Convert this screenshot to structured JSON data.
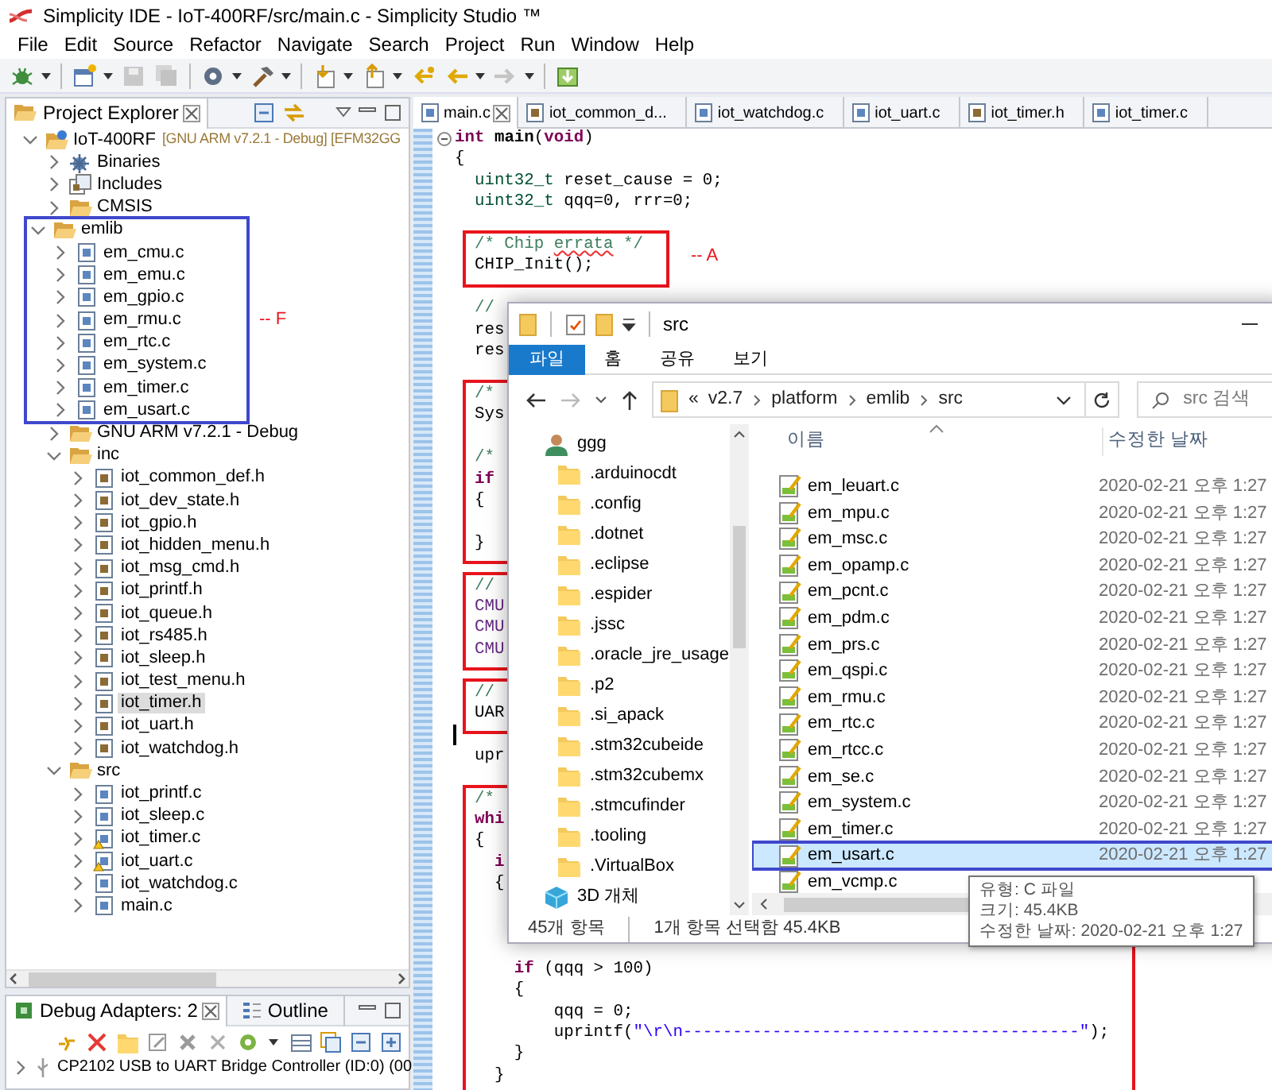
{
  "window": {
    "title": "Simplicity IDE - IoT-400RF/src/main.c - Simplicity Studio ™"
  },
  "menu": [
    "File",
    "Edit",
    "Source",
    "Refactor",
    "Navigate",
    "Search",
    "Project",
    "Run",
    "Window",
    "Help"
  ],
  "project_explorer": {
    "title": "Project Explorer",
    "tree": [
      {
        "label": "IoT-400RF",
        "kind": "project",
        "decoration": "[GNU ARM v7.2.1 - Debug] [EFM32GG",
        "expanded": true,
        "selected": false,
        "children": [
          {
            "label": "Binaries",
            "kind": "binaries",
            "expanded": false,
            "selected": false
          },
          {
            "label": "Includes",
            "kind": "includes",
            "expanded": false,
            "selected": false
          },
          {
            "label": "CMSIS",
            "kind": "folder",
            "expanded": false,
            "selected": false
          },
          {
            "label": "emlib",
            "kind": "folder",
            "expanded": true,
            "selected": false,
            "note": "-- F",
            "children": [
              {
                "label": "em_cmu.c",
                "kind": "c-file",
                "expanded": false,
                "selected": false
              },
              {
                "label": "em_emu.c",
                "kind": "c-file",
                "expanded": false,
                "selected": false
              },
              {
                "label": "em_gpio.c",
                "kind": "c-file",
                "expanded": false,
                "selected": false
              },
              {
                "label": "em_rmu.c",
                "kind": "c-file",
                "expanded": false,
                "selected": false
              },
              {
                "label": "em_rtc.c",
                "kind": "c-file",
                "expanded": false,
                "selected": false
              },
              {
                "label": "em_system.c",
                "kind": "c-file",
                "expanded": false,
                "selected": false
              },
              {
                "label": "em_timer.c",
                "kind": "c-file",
                "expanded": false,
                "selected": false
              },
              {
                "label": "em_usart.c",
                "kind": "c-file",
                "expanded": false,
                "selected": false
              }
            ]
          },
          {
            "label": "GNU ARM v7.2.1 - Debug",
            "kind": "folder",
            "expanded": false,
            "selected": false
          },
          {
            "label": "inc",
            "kind": "folder",
            "expanded": true,
            "selected": false,
            "children": [
              {
                "label": "iot_common_def.h",
                "kind": "h-file",
                "expanded": false,
                "selected": false
              },
              {
                "label": "iot_dev_state.h",
                "kind": "h-file",
                "expanded": false,
                "selected": false
              },
              {
                "label": "iot_gpio.h",
                "kind": "h-file",
                "expanded": false,
                "selected": false
              },
              {
                "label": "iot_hidden_menu.h",
                "kind": "h-file",
                "expanded": false,
                "selected": false
              },
              {
                "label": "iot_msg_cmd.h",
                "kind": "h-file",
                "expanded": false,
                "selected": false
              },
              {
                "label": "iot_printf.h",
                "kind": "h-file",
                "expanded": false,
                "selected": false
              },
              {
                "label": "iot_queue.h",
                "kind": "h-file",
                "expanded": false,
                "selected": false
              },
              {
                "label": "iot_rs485.h",
                "kind": "h-file",
                "expanded": false,
                "selected": false
              },
              {
                "label": "iot_sleep.h",
                "kind": "h-file",
                "expanded": false,
                "selected": false
              },
              {
                "label": "iot_test_menu.h",
                "kind": "h-file",
                "expanded": false,
                "selected": false
              },
              {
                "label": "iot_timer.h",
                "kind": "h-file",
                "expanded": false,
                "selected": true
              },
              {
                "label": "iot_uart.h",
                "kind": "h-file",
                "expanded": false,
                "selected": false
              },
              {
                "label": "iot_watchdog.h",
                "kind": "h-file",
                "expanded": false,
                "selected": false
              }
            ]
          },
          {
            "label": "src",
            "kind": "folder",
            "expanded": true,
            "selected": false,
            "children": [
              {
                "label": "iot_printf.c",
                "kind": "c-file",
                "expanded": false,
                "selected": false
              },
              {
                "label": "iot_sleep.c",
                "kind": "c-file",
                "expanded": false,
                "selected": false
              },
              {
                "label": "iot_timer.c",
                "kind": "c-file",
                "warning": true,
                "expanded": false,
                "selected": false
              },
              {
                "label": "iot_uart.c",
                "kind": "c-file",
                "warning": true,
                "expanded": false,
                "selected": false
              },
              {
                "label": "iot_watchdog.c",
                "kind": "c-file",
                "expanded": false,
                "selected": false
              },
              {
                "label": "main.c",
                "kind": "c-file",
                "expanded": false,
                "selected": false
              }
            ]
          }
        ]
      }
    ]
  },
  "debug_panel": {
    "tabs": [
      {
        "label": "Debug Adapters: 2",
        "selected": true
      },
      {
        "label": "Outline",
        "selected": false
      }
    ],
    "rows": [
      {
        "label": "CP2102 USB to UART Bridge Controller (ID:0) (00",
        "expanded": false
      }
    ]
  },
  "editor": {
    "tabs": [
      {
        "label": "main.c",
        "kind": "c",
        "selected": true
      },
      {
        "label": "iot_common_d...",
        "kind": "h",
        "selected": false
      },
      {
        "label": "iot_watchdog.c",
        "kind": "c",
        "selected": false
      },
      {
        "label": "iot_uart.c",
        "kind": "c",
        "selected": false
      },
      {
        "label": "iot_timer.h",
        "kind": "h",
        "selected": false
      },
      {
        "label": "iot_timer.c",
        "kind": "c",
        "selected": false
      }
    ],
    "blocks": [
      {
        "framed": false,
        "lines": [
          {
            "kind": "code",
            "foldable": true,
            "segments": [
              {
                "text": "int",
                "kind": "keyword"
              },
              {
                "text": " main",
                "kind": "function"
              },
              {
                "text": "(",
                "kind": "plain"
              },
              {
                "text": "void",
                "kind": "keyword"
              },
              {
                "text": ")",
                "kind": "plain"
              }
            ]
          },
          {
            "kind": "code",
            "segments": [
              {
                "text": "{",
                "kind": "plain"
              }
            ]
          },
          {
            "kind": "code",
            "segments": [
              {
                "text": "  uint32_t",
                "kind": "type"
              },
              {
                "text": " reset_cause = 0;",
                "kind": "plain"
              }
            ]
          },
          {
            "kind": "code",
            "segments": [
              {
                "text": "  uint32_t",
                "kind": "type"
              },
              {
                "text": " qqq=0, rrr=0;",
                "kind": "plain"
              }
            ]
          },
          {
            "kind": "blank"
          }
        ]
      },
      {
        "framed": true,
        "note": "-- A",
        "lines": [
          {
            "kind": "code",
            "segments": [
              {
                "text": "  /* Chip ",
                "kind": "comment"
              },
              {
                "text": "errata",
                "kind": "misspelled"
              },
              {
                "text": " */",
                "kind": "comment"
              }
            ]
          },
          {
            "kind": "code",
            "segments": [
              {
                "text": "  CHIP_Init();",
                "kind": "plain"
              }
            ]
          }
        ]
      },
      {
        "framed": false,
        "lines": [
          {
            "kind": "blank"
          },
          {
            "kind": "code",
            "segments": [
              {
                "text": "  //",
                "kind": "comment"
              }
            ]
          },
          {
            "kind": "code",
            "segments": [
              {
                "text": "  res",
                "kind": "plain"
              }
            ]
          },
          {
            "kind": "code",
            "segments": [
              {
                "text": "  res",
                "kind": "plain"
              }
            ]
          },
          {
            "kind": "blank"
          }
        ]
      },
      {
        "framed": true,
        "lines": [
          {
            "kind": "code",
            "segments": [
              {
                "text": "  /*",
                "kind": "comment"
              }
            ]
          },
          {
            "kind": "code",
            "segments": [
              {
                "text": "  Sys",
                "kind": "plain"
              }
            ]
          },
          {
            "kind": "blank"
          },
          {
            "kind": "code",
            "segments": [
              {
                "text": "  /*",
                "kind": "comment"
              }
            ]
          },
          {
            "kind": "code",
            "segments": [
              {
                "text": "  if",
                "kind": "keyword"
              }
            ]
          },
          {
            "kind": "code",
            "segments": [
              {
                "text": "  {",
                "kind": "plain"
              }
            ]
          },
          {
            "kind": "blank"
          },
          {
            "kind": "code",
            "segments": [
              {
                "text": "  }",
                "kind": "plain"
              }
            ]
          }
        ]
      },
      {
        "framed": false,
        "lines": [
          {
            "kind": "blank"
          }
        ]
      },
      {
        "framed": true,
        "lines": [
          {
            "kind": "code",
            "segments": [
              {
                "text": "  //",
                "kind": "comment"
              }
            ]
          },
          {
            "kind": "code",
            "segments": [
              {
                "text": "  CMU",
                "kind": "macro"
              }
            ]
          },
          {
            "kind": "code",
            "segments": [
              {
                "text": "  CMU",
                "kind": "macro"
              }
            ]
          },
          {
            "kind": "code",
            "segments": [
              {
                "text": "  CMU",
                "kind": "macro"
              }
            ]
          }
        ]
      },
      {
        "framed": false,
        "lines": [
          {
            "kind": "blank"
          }
        ]
      },
      {
        "framed": true,
        "lines": [
          {
            "kind": "code",
            "segments": [
              {
                "text": "  //",
                "kind": "comment"
              }
            ]
          },
          {
            "kind": "code",
            "segments": [
              {
                "text": "  UAR",
                "kind": "plain"
              }
            ]
          }
        ]
      },
      {
        "framed": false,
        "lines": [
          {
            "kind": "caret"
          },
          {
            "kind": "code",
            "segments": [
              {
                "text": "  upr",
                "kind": "plain"
              }
            ]
          },
          {
            "kind": "blank"
          }
        ]
      },
      {
        "framed": true,
        "lines": [
          {
            "kind": "code",
            "segments": [
              {
                "text": "  /*",
                "kind": "comment"
              }
            ]
          },
          {
            "kind": "code",
            "segments": [
              {
                "text": "  whi",
                "kind": "keyword"
              }
            ]
          },
          {
            "kind": "code",
            "segments": [
              {
                "text": "  {",
                "kind": "plain"
              }
            ]
          },
          {
            "kind": "code",
            "segments": [
              {
                "text": "    i",
                "kind": "keyword"
              }
            ]
          },
          {
            "kind": "code",
            "segments": [
              {
                "text": "    {",
                "kind": "plain"
              }
            ]
          },
          {
            "kind": "blank"
          },
          {
            "kind": "blank"
          },
          {
            "kind": "blank"
          },
          {
            "kind": "code",
            "segments": [
              {
                "text": "      if",
                "kind": "keyword"
              },
              {
                "text": " (qqq > 100)",
                "kind": "plain"
              }
            ]
          },
          {
            "kind": "code",
            "segments": [
              {
                "text": "      {",
                "kind": "plain"
              }
            ]
          },
          {
            "kind": "code",
            "segments": [
              {
                "text": "          qqq = 0;",
                "kind": "plain"
              }
            ]
          },
          {
            "kind": "code",
            "segments": [
              {
                "text": "          uprintf(",
                "kind": "plain"
              },
              {
                "text": "\"\\r\\n----------------------------------------\"",
                "kind": "string"
              },
              {
                "text": ");",
                "kind": "plain"
              }
            ]
          },
          {
            "kind": "code",
            "segments": [
              {
                "text": "      }",
                "kind": "plain"
              }
            ]
          },
          {
            "kind": "code",
            "segments": [
              {
                "text": "    }",
                "kind": "plain"
              }
            ]
          }
        ]
      }
    ]
  },
  "file_explorer": {
    "title": "src",
    "ribbon_tabs": [
      {
        "label": "파일",
        "selected": true
      },
      {
        "label": "홈",
        "selected": false
      },
      {
        "label": "공유",
        "selected": false
      },
      {
        "label": "보기",
        "selected": false
      }
    ],
    "overflow": "«",
    "path": [
      "v2.7",
      "platform",
      "emlib",
      "src"
    ],
    "search": {
      "placeholder": "src 검색"
    },
    "nav": [
      {
        "label": "ggg",
        "kind": "user",
        "selected": false
      },
      {
        "label": ".arduinocdt",
        "kind": "folder",
        "selected": false
      },
      {
        "label": ".config",
        "kind": "folder",
        "selected": false
      },
      {
        "label": ".dotnet",
        "kind": "folder",
        "selected": false
      },
      {
        "label": ".eclipse",
        "kind": "folder",
        "selected": false
      },
      {
        "label": ".espider",
        "kind": "folder",
        "selected": false
      },
      {
        "label": ".jssc",
        "kind": "folder",
        "selected": false
      },
      {
        "label": ".oracle_jre_usage",
        "kind": "folder",
        "selected": false
      },
      {
        "label": ".p2",
        "kind": "folder",
        "selected": false
      },
      {
        "label": ".si_apack",
        "kind": "folder",
        "selected": false
      },
      {
        "label": ".stm32cubeide",
        "kind": "folder",
        "selected": false
      },
      {
        "label": ".stm32cubemx",
        "kind": "folder",
        "selected": false
      },
      {
        "label": ".stmcufinder",
        "kind": "folder",
        "selected": false
      },
      {
        "label": ".tooling",
        "kind": "folder",
        "selected": false
      },
      {
        "label": ".VirtualBox",
        "kind": "folder",
        "selected": false
      },
      {
        "label": "3D 개체",
        "kind": "objects3d",
        "selected": false
      }
    ],
    "columns": [
      "이름",
      "수정한 날짜"
    ],
    "files": [
      {
        "name": "em_leuart.c",
        "date": "2020-02-21 오후 1:27",
        "selected": false,
        "framed": false
      },
      {
        "name": "em_mpu.c",
        "date": "2020-02-21 오후 1:27",
        "selected": false,
        "framed": false
      },
      {
        "name": "em_msc.c",
        "date": "2020-02-21 오후 1:27",
        "selected": false,
        "framed": false
      },
      {
        "name": "em_opamp.c",
        "date": "2020-02-21 오후 1:27",
        "selected": false,
        "framed": false
      },
      {
        "name": "em_pcnt.c",
        "date": "2020-02-21 오후 1:27",
        "selected": false,
        "framed": false
      },
      {
        "name": "em_pdm.c",
        "date": "2020-02-21 오후 1:27",
        "selected": false,
        "framed": false
      },
      {
        "name": "em_prs.c",
        "date": "2020-02-21 오후 1:27",
        "selected": false,
        "framed": false
      },
      {
        "name": "em_qspi.c",
        "date": "2020-02-21 오후 1:27",
        "selected": false,
        "framed": false
      },
      {
        "name": "em_rmu.c",
        "date": "2020-02-21 오후 1:27",
        "selected": false,
        "framed": false
      },
      {
        "name": "em_rtc.c",
        "date": "2020-02-21 오후 1:27",
        "selected": false,
        "framed": false
      },
      {
        "name": "em_rtcc.c",
        "date": "2020-02-21 오후 1:27",
        "selected": false,
        "framed": false
      },
      {
        "name": "em_se.c",
        "date": "2020-02-21 오후 1:27",
        "selected": false,
        "framed": false
      },
      {
        "name": "em_system.c",
        "date": "2020-02-21 오후 1:27",
        "selected": false,
        "framed": false
      },
      {
        "name": "em_timer.c",
        "date": "2020-02-21 오후 1:27",
        "selected": false,
        "framed": false
      },
      {
        "name": "em_usart.c",
        "date": "2020-02-21 오후 1:27",
        "selected": true,
        "framed": true
      },
      {
        "name": "em_vcmp.c",
        "selected": false,
        "framed": false
      }
    ],
    "status": [
      "45개 항목",
      "1개 항목 선택함 45.4KB"
    ],
    "tooltip": [
      "유형: C 파일",
      "크기: 45.4KB",
      "수정한 날짜: 2020-02-21 오후 1:27"
    ]
  }
}
